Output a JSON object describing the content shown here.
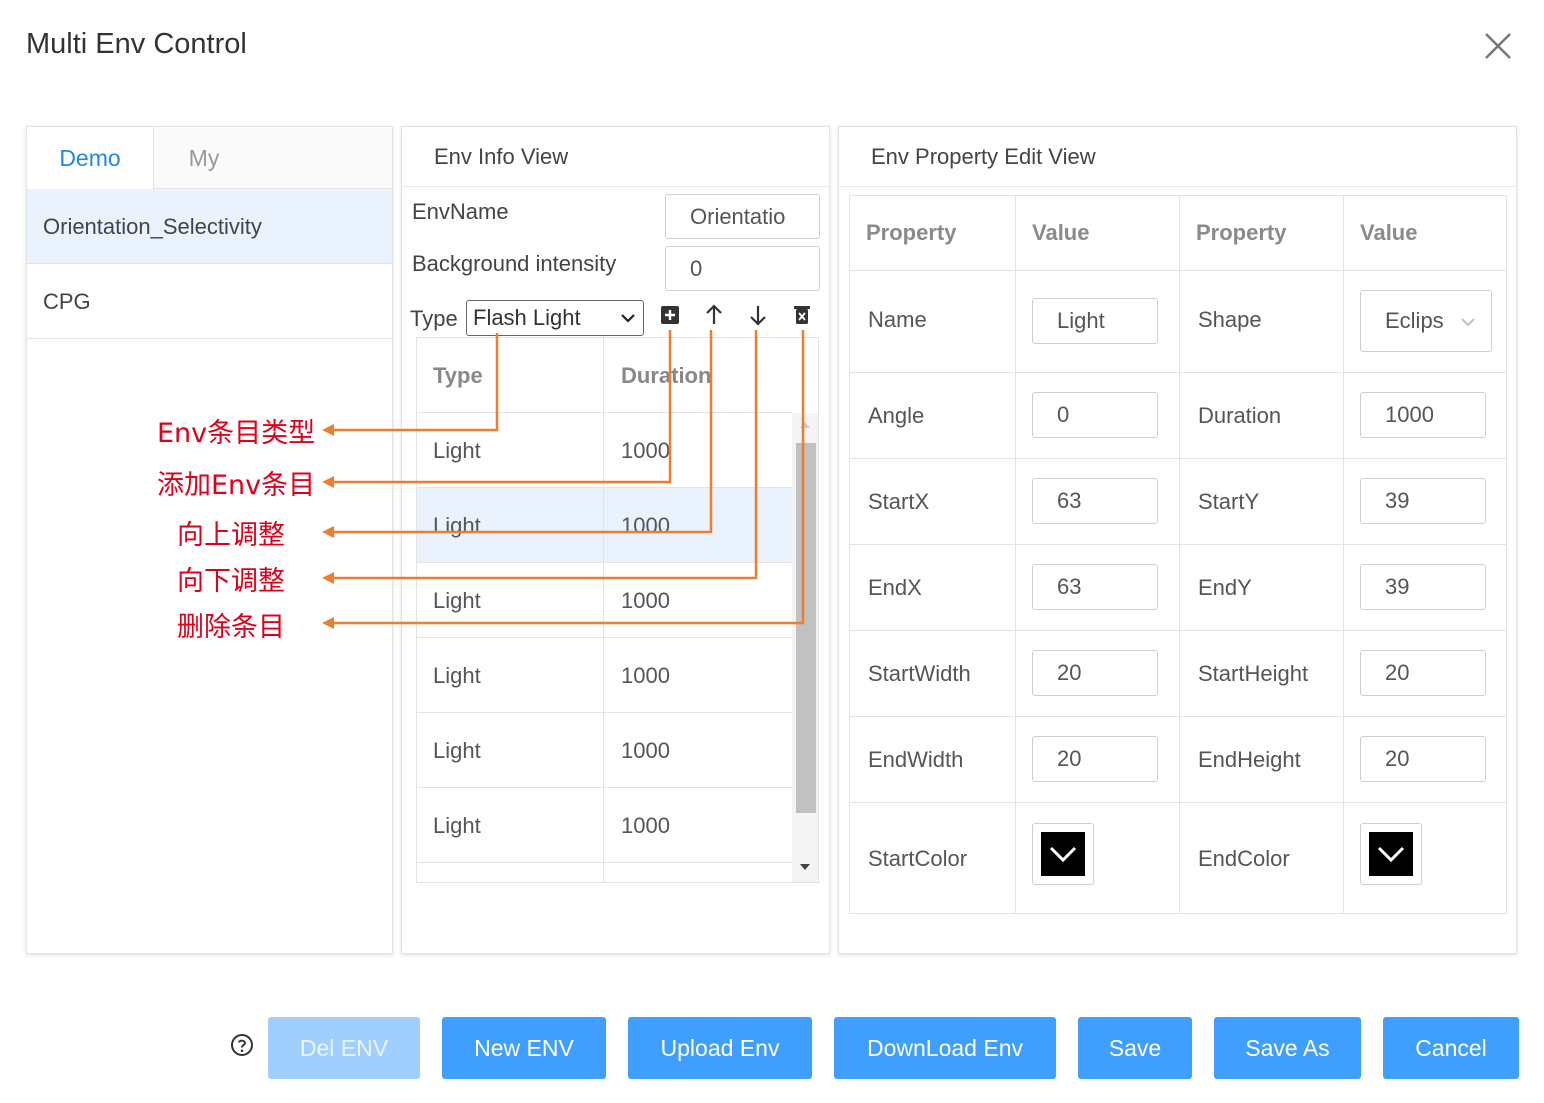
{
  "dialog": {
    "title": "Multi Env Control"
  },
  "left": {
    "tabs": [
      "Demo",
      "My"
    ],
    "items": [
      "Orientation_Selectivity",
      "CPG"
    ]
  },
  "middle": {
    "title": "Env Info View",
    "env_name_label": "EnvName",
    "env_name_value": "Orientatio",
    "bg_label": "Background intensity",
    "bg_value": "0",
    "type_label": "Type",
    "type_value": "Flash Light",
    "grid": {
      "headers": [
        "Type",
        "Duration"
      ],
      "rows": [
        [
          "Light",
          "1000"
        ],
        [
          "Light",
          "1000"
        ],
        [
          "Light",
          "1000"
        ],
        [
          "Light",
          "1000"
        ],
        [
          "Light",
          "1000"
        ],
        [
          "Light",
          "1000"
        ]
      ]
    }
  },
  "right": {
    "title": "Env Property Edit View",
    "headers": [
      "Property",
      "Value",
      "Property",
      "Value"
    ],
    "rows": [
      {
        "p1": "Name",
        "v1": "Light",
        "p2": "Shape",
        "v2": "Eclips"
      },
      {
        "p1": "Angle",
        "v1": "0",
        "p2": "Duration",
        "v2": "1000"
      },
      {
        "p1": "StartX",
        "v1": "63",
        "p2": "StartY",
        "v2": "39"
      },
      {
        "p1": "EndX",
        "v1": "63",
        "p2": "EndY",
        "v2": "39"
      },
      {
        "p1": "StartWidth",
        "v1": "20",
        "p2": "StartHeight",
        "v2": "20"
      },
      {
        "p1": "EndWidth",
        "v1": "20",
        "p2": "EndHeight",
        "v2": "20"
      },
      {
        "p1": "StartColor",
        "p2": "EndColor"
      }
    ],
    "start_color": "#000000",
    "end_color": "#000000"
  },
  "buttons": {
    "del": "Del ENV",
    "new": "New ENV",
    "upload": "Upload Env",
    "download": "DownLoad Env",
    "save": "Save",
    "save_as": "Save As",
    "cancel": "Cancel"
  },
  "annotations": {
    "type": "Env条目类型",
    "add": "添加Env条目",
    "up": "向上调整",
    "down": "向下调整",
    "delete": "删除条目"
  },
  "colors": {
    "accent": "#409eff",
    "disabled": "#a0cfff",
    "annotation": "#e0001a",
    "leader": "#ed7d31"
  }
}
